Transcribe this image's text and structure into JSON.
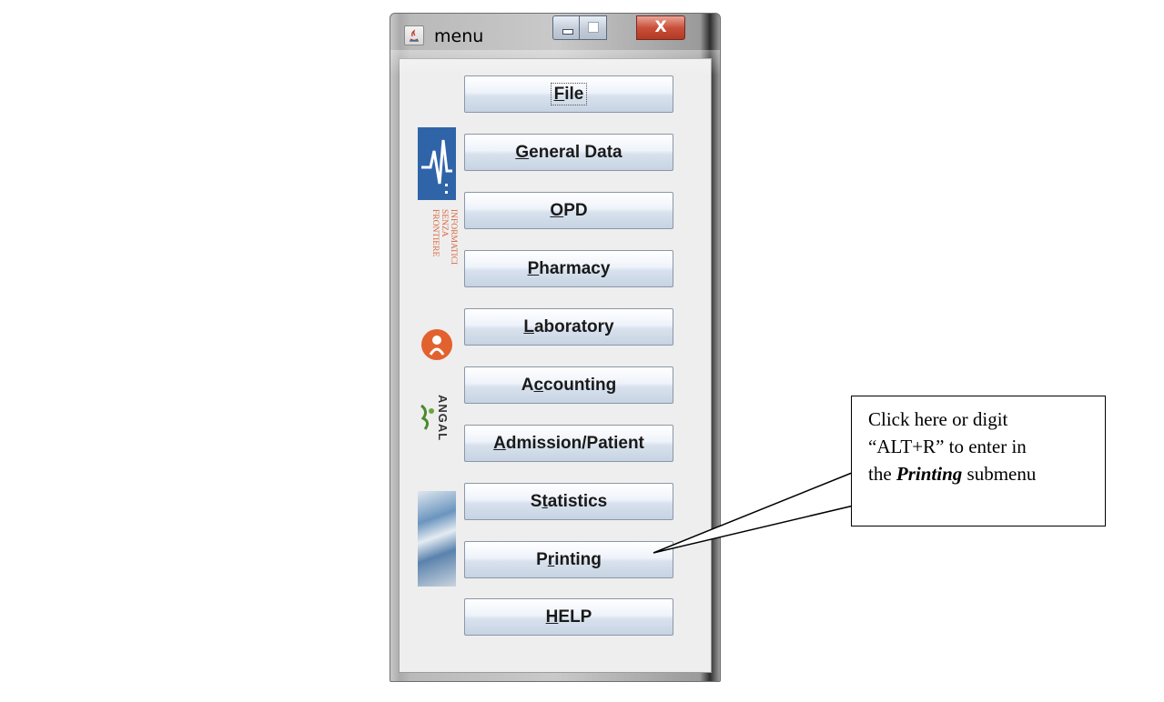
{
  "window": {
    "title": "menu",
    "close_glyph": "X"
  },
  "logos": {
    "isf_text": "INFORMATICI\nSENZA\nFRONTIERE",
    "angal_text": "ANGAL"
  },
  "menu": {
    "buttons": [
      {
        "label": "File",
        "mnemonic": "F",
        "focused": true
      },
      {
        "label": "General Data",
        "mnemonic": "G"
      },
      {
        "label": "OPD",
        "mnemonic": "O"
      },
      {
        "label": "Pharmacy",
        "mnemonic": "P"
      },
      {
        "label": "Laboratory",
        "mnemonic": "L"
      },
      {
        "label": "Accounting",
        "mnemonic": "c"
      },
      {
        "label": "Admission/Patient",
        "mnemonic": "A"
      },
      {
        "label": "Statistics",
        "mnemonic": "t"
      },
      {
        "label": "Printing",
        "mnemonic": "r"
      },
      {
        "label": "HELP",
        "mnemonic": "H"
      }
    ]
  },
  "callout": {
    "line1": "Click here or digit",
    "line2": "“ALT+R” to enter in",
    "line3_pre": "the ",
    "line3_em": "Printing",
    "line3_post": " submenu"
  },
  "colors": {
    "button_border": "#8a97a8",
    "close_red": "#c9503a",
    "isf_orange": "#d9653c",
    "asm_blue": "#2f65a8"
  }
}
